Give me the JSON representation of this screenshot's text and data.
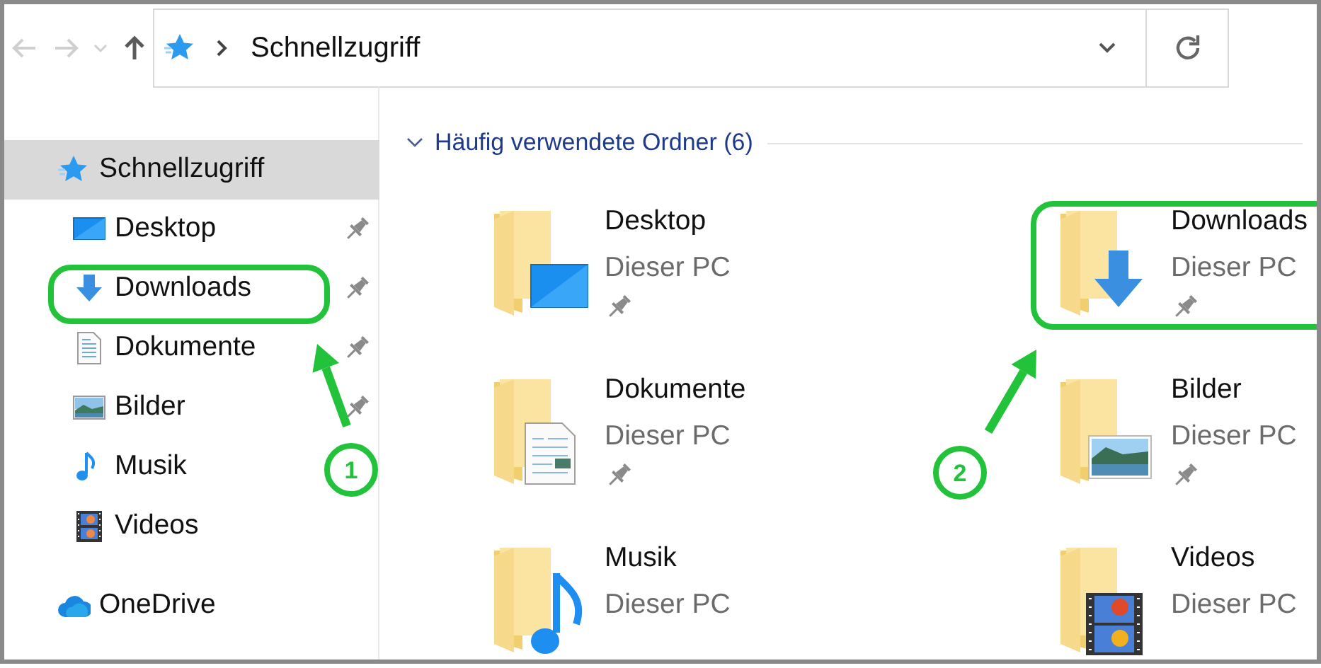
{
  "toolbar": {
    "back": {
      "disabled": true
    },
    "forward": {
      "disabled": true
    },
    "up": {
      "disabled": false
    }
  },
  "address_bar": {
    "path": "Schnellzugriff"
  },
  "sidebar": {
    "items": [
      {
        "label": "Schnellzugriff",
        "kind": "quickaccess",
        "selected": true,
        "pinned": false,
        "children": [
          {
            "label": "Desktop",
            "kind": "desktop",
            "selected": false,
            "pinned": true
          },
          {
            "label": "Downloads",
            "kind": "downloads",
            "selected": false,
            "pinned": true
          },
          {
            "label": "Dokumente",
            "kind": "documents",
            "selected": false,
            "pinned": true
          },
          {
            "label": "Bilder",
            "kind": "pictures",
            "selected": false,
            "pinned": true
          },
          {
            "label": "Musik",
            "kind": "music",
            "selected": false,
            "pinned": false
          },
          {
            "label": "Videos",
            "kind": "videos",
            "selected": false,
            "pinned": false
          }
        ]
      },
      {
        "label": "OneDrive",
        "kind": "cloud",
        "selected": false,
        "pinned": false
      }
    ]
  },
  "group": {
    "title": "Häufig verwendete Ordner (6)",
    "expanded": true,
    "tiles": [
      {
        "name": "Desktop",
        "location": "Dieser PC",
        "kind": "desktop",
        "pinned": true
      },
      {
        "name": "Downloads",
        "location": "Dieser PC",
        "kind": "downloads",
        "pinned": true
      },
      {
        "name": "Dokumente",
        "location": "Dieser PC",
        "kind": "documents",
        "pinned": true
      },
      {
        "name": "Bilder",
        "location": "Dieser PC",
        "kind": "pictures",
        "pinned": true
      },
      {
        "name": "Musik",
        "location": "Dieser PC",
        "kind": "music",
        "pinned": false
      },
      {
        "name": "Videos",
        "location": "Dieser PC",
        "kind": "videos",
        "pinned": false
      }
    ]
  },
  "annotations": [
    {
      "label": "1"
    },
    {
      "label": "2"
    }
  ]
}
